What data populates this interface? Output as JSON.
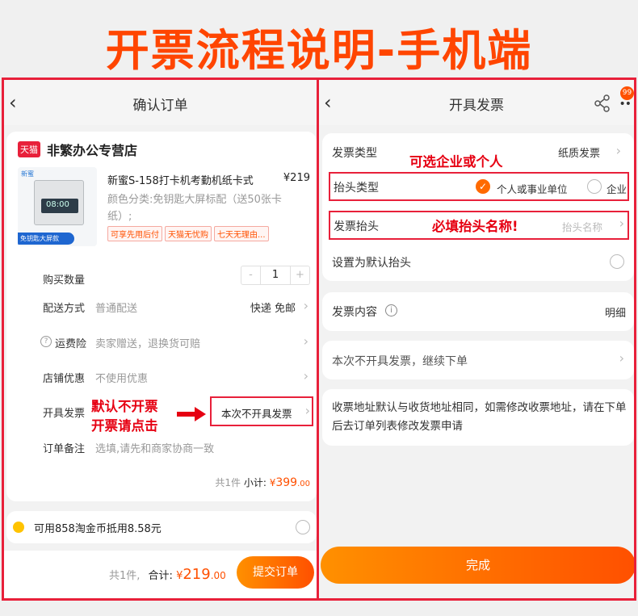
{
  "banner": {
    "title": "开票流程说明-手机端"
  },
  "left": {
    "nav_title": "确认订单",
    "shop": {
      "badge": "天猫",
      "name": "非繁办公专营店"
    },
    "product": {
      "title": "新蜜S-158打卡机考勤机纸卡式",
      "price": "¥219",
      "variant": "颜色分类:免钥匙大屏标配（送50张卡纸）;",
      "tags": [
        "可享先用后付",
        "天猫无忧购",
        "七天无理由..."
      ],
      "img_brand": "新蜜",
      "img_display": "08:00",
      "img_banner": "免钥匙大屏款"
    },
    "quantity": {
      "label": "购买数量",
      "minus": "-",
      "value": "1",
      "plus": "+"
    },
    "shipping": {
      "label": "配送方式",
      "sub": "普通配送",
      "value": "快递 免邮"
    },
    "insurance": {
      "label": "运费险",
      "sub": "卖家赠送，退换货可赔"
    },
    "discount": {
      "label": "店铺优惠",
      "sub": "不使用优惠"
    },
    "invoice": {
      "label": "开具发票",
      "value": "本次不开具发票"
    },
    "remark": {
      "label": "订单备注",
      "placeholder": "选填,请先和商家协商一致"
    },
    "subtotal": {
      "count": "共1件",
      "label": "小计:",
      "currency": "¥",
      "amount": "399",
      "decimals": ".00"
    },
    "coins": {
      "text": "可用858淘金币抵用8.58元"
    },
    "bottom": {
      "count": "共1件,",
      "label": "合计:",
      "currency": "¥",
      "amount": "219",
      "decimals": ".00",
      "submit": "提交订单"
    },
    "annotation": {
      "line1": "默认不开票",
      "line2": "开票请点击"
    }
  },
  "right": {
    "nav_title": "开具发票",
    "badge_count": "99",
    "type": {
      "label": "发票类型",
      "value": "纸质发票"
    },
    "title_type": {
      "label": "抬头类型",
      "opt1": "个人或事业单位",
      "opt2": "企业"
    },
    "title_name": {
      "label": "发票抬头",
      "placeholder": "抬头名称"
    },
    "default_title": {
      "label": "设置为默认抬头"
    },
    "content": {
      "label": "发票内容",
      "value": "明细"
    },
    "skip": {
      "label": "本次不开具发票，继续下单"
    },
    "note": {
      "text": "收票地址默认与收货地址相同，如需修改收票地址，请在下单后去订单列表修改发票申请"
    },
    "done": "完成",
    "annotation_type": "可选企业或个人",
    "annotation_title": "必填抬头名称!"
  },
  "colors": {
    "accent": "#ff5000",
    "annotation": "#e60012",
    "frame": "#e8203a"
  }
}
